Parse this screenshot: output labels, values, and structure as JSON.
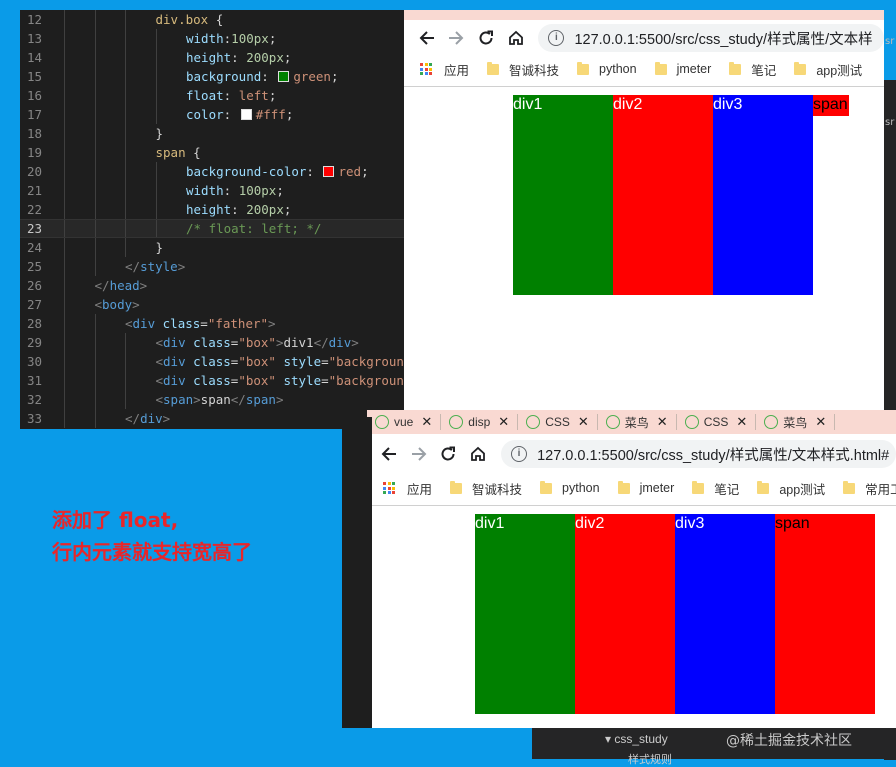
{
  "editor": {
    "lines": [
      {
        "n": "12",
        "indent": 3,
        "tokens": [
          {
            "t": "div.box ",
            "c": "t-sel"
          },
          {
            "t": "{",
            "c": "t-txt"
          }
        ]
      },
      {
        "n": "13",
        "indent": 4,
        "tokens": [
          {
            "t": "width",
            "c": "t-prop"
          },
          {
            "t": ":",
            "c": "t-txt"
          },
          {
            "t": "100px",
            "c": "t-num"
          },
          {
            "t": ";",
            "c": "t-txt"
          }
        ]
      },
      {
        "n": "14",
        "indent": 4,
        "tokens": [
          {
            "t": "height",
            "c": "t-prop"
          },
          {
            "t": ": ",
            "c": "t-txt"
          },
          {
            "t": "200px",
            "c": "t-num"
          },
          {
            "t": ";",
            "c": "t-txt"
          }
        ]
      },
      {
        "n": "15",
        "indent": 4,
        "tokens": [
          {
            "t": "background",
            "c": "t-prop"
          },
          {
            "t": ": ",
            "c": "t-txt"
          },
          {
            "swatch": "#008000"
          },
          {
            "t": "green",
            "c": "t-val"
          },
          {
            "t": ";",
            "c": "t-txt"
          }
        ]
      },
      {
        "n": "16",
        "indent": 4,
        "tokens": [
          {
            "t": "float",
            "c": "t-prop"
          },
          {
            "t": ": ",
            "c": "t-txt"
          },
          {
            "t": "left",
            "c": "t-val"
          },
          {
            "t": ";",
            "c": "t-txt"
          }
        ]
      },
      {
        "n": "17",
        "indent": 4,
        "tokens": [
          {
            "t": "color",
            "c": "t-prop"
          },
          {
            "t": ": ",
            "c": "t-txt"
          },
          {
            "swatch": "#ffffff"
          },
          {
            "t": "#fff",
            "c": "t-val"
          },
          {
            "t": ";",
            "c": "t-txt"
          }
        ]
      },
      {
        "n": "18",
        "indent": 3,
        "tokens": [
          {
            "t": "}",
            "c": "t-txt"
          }
        ]
      },
      {
        "n": "19",
        "indent": 3,
        "tokens": [
          {
            "t": "span ",
            "c": "t-sel"
          },
          {
            "t": "{",
            "c": "t-txt"
          }
        ]
      },
      {
        "n": "20",
        "indent": 4,
        "tokens": [
          {
            "t": "background-color",
            "c": "t-prop"
          },
          {
            "t": ": ",
            "c": "t-txt"
          },
          {
            "swatch": "#ff0000"
          },
          {
            "t": "red",
            "c": "t-val"
          },
          {
            "t": ";",
            "c": "t-txt"
          }
        ]
      },
      {
        "n": "21",
        "indent": 4,
        "tokens": [
          {
            "t": "width",
            "c": "t-prop"
          },
          {
            "t": ": ",
            "c": "t-txt"
          },
          {
            "t": "100px",
            "c": "t-num"
          },
          {
            "t": ";",
            "c": "t-txt"
          }
        ]
      },
      {
        "n": "22",
        "indent": 4,
        "tokens": [
          {
            "t": "height",
            "c": "t-prop"
          },
          {
            "t": ": ",
            "c": "t-txt"
          },
          {
            "t": "200px",
            "c": "t-num"
          },
          {
            "t": ";",
            "c": "t-txt"
          }
        ]
      },
      {
        "n": "23",
        "indent": 4,
        "current": true,
        "tokens": [
          {
            "t": "/* float: left; */",
            "c": "t-com"
          }
        ]
      },
      {
        "n": "24",
        "indent": 3,
        "tokens": [
          {
            "t": "}",
            "c": "t-txt"
          }
        ]
      },
      {
        "n": "25",
        "indent": 2,
        "tokens": [
          {
            "t": "</",
            "c": "t-pun"
          },
          {
            "t": "style",
            "c": "t-tag"
          },
          {
            "t": ">",
            "c": "t-pun"
          }
        ]
      },
      {
        "n": "26",
        "indent": 1,
        "tokens": [
          {
            "t": "</",
            "c": "t-pun"
          },
          {
            "t": "head",
            "c": "t-tag"
          },
          {
            "t": ">",
            "c": "t-pun"
          }
        ]
      },
      {
        "n": "27",
        "indent": 1,
        "tokens": [
          {
            "t": "<",
            "c": "t-pun"
          },
          {
            "t": "body",
            "c": "t-tag"
          },
          {
            "t": ">",
            "c": "t-pun"
          }
        ]
      },
      {
        "n": "28",
        "indent": 2,
        "tokens": [
          {
            "t": "<",
            "c": "t-pun"
          },
          {
            "t": "div ",
            "c": "t-tag"
          },
          {
            "t": "class",
            "c": "t-attr"
          },
          {
            "t": "=",
            "c": "t-txt"
          },
          {
            "t": "\"father\"",
            "c": "t-str"
          },
          {
            "t": ">",
            "c": "t-pun"
          }
        ]
      },
      {
        "n": "29",
        "indent": 3,
        "tokens": [
          {
            "t": "<",
            "c": "t-pun"
          },
          {
            "t": "div ",
            "c": "t-tag"
          },
          {
            "t": "class",
            "c": "t-attr"
          },
          {
            "t": "=",
            "c": "t-txt"
          },
          {
            "t": "\"box\"",
            "c": "t-str"
          },
          {
            "t": ">",
            "c": "t-pun"
          },
          {
            "t": "div1",
            "c": "t-txt"
          },
          {
            "t": "</",
            "c": "t-pun"
          },
          {
            "t": "div",
            "c": "t-tag"
          },
          {
            "t": ">",
            "c": "t-pun"
          }
        ]
      },
      {
        "n": "30",
        "indent": 3,
        "tokens": [
          {
            "t": "<",
            "c": "t-pun"
          },
          {
            "t": "div ",
            "c": "t-tag"
          },
          {
            "t": "class",
            "c": "t-attr"
          },
          {
            "t": "=",
            "c": "t-txt"
          },
          {
            "t": "\"box\" ",
            "c": "t-str"
          },
          {
            "t": "style",
            "c": "t-attr"
          },
          {
            "t": "=",
            "c": "t-txt"
          },
          {
            "t": "\"background-c",
            "c": "t-str"
          }
        ]
      },
      {
        "n": "31",
        "indent": 3,
        "tokens": [
          {
            "t": "<",
            "c": "t-pun"
          },
          {
            "t": "div ",
            "c": "t-tag"
          },
          {
            "t": "class",
            "c": "t-attr"
          },
          {
            "t": "=",
            "c": "t-txt"
          },
          {
            "t": "\"box\" ",
            "c": "t-str"
          },
          {
            "t": "style",
            "c": "t-attr"
          },
          {
            "t": "=",
            "c": "t-txt"
          },
          {
            "t": "\"background-c",
            "c": "t-str"
          }
        ]
      },
      {
        "n": "32",
        "indent": 3,
        "tokens": [
          {
            "t": "<",
            "c": "t-pun"
          },
          {
            "t": "span",
            "c": "t-tag"
          },
          {
            "t": ">",
            "c": "t-pun"
          },
          {
            "t": "span",
            "c": "t-txt"
          },
          {
            "t": "</",
            "c": "t-pun"
          },
          {
            "t": "span",
            "c": "t-tag"
          },
          {
            "t": ">",
            "c": "t-pun"
          }
        ]
      },
      {
        "n": "33",
        "indent": 2,
        "tokens": [
          {
            "t": "</",
            "c": "t-pun"
          },
          {
            "t": "div",
            "c": "t-tag"
          },
          {
            "t": ">",
            "c": "t-pun"
          }
        ]
      }
    ]
  },
  "browser1": {
    "url": "127.0.0.1:5500/src/css_study/样式属性/文本样",
    "bookmarks": [
      "应用",
      "智诚科技",
      "python",
      "jmeter",
      "笔记",
      "app测试"
    ],
    "boxes": [
      {
        "label": "div1",
        "color": "#008000"
      },
      {
        "label": "div2",
        "color": "#ff0000"
      },
      {
        "label": "div3",
        "color": "#0000ff"
      }
    ],
    "span_label": "span"
  },
  "browser2": {
    "tabs": [
      "vue",
      "disp",
      "CSS",
      "菜鸟",
      "CSS",
      "菜鸟"
    ],
    "url": "127.0.0.1:5500/src/css_study/样式属性/文本样式.html#",
    "bookmarks": [
      "应用",
      "智诚科技",
      "python",
      "jmeter",
      "笔记",
      "app测试",
      "常用工"
    ],
    "boxes": [
      {
        "label": "div1",
        "color": "#008000"
      },
      {
        "label": "div2",
        "color": "#ff0000"
      },
      {
        "label": "div3",
        "color": "#0000ff"
      },
      {
        "label": "span",
        "color": "#ff0000"
      }
    ]
  },
  "note": {
    "line1": "添加了 float,",
    "line2": "行内元素就支持宽高了"
  },
  "explorer": {
    "folder": "css_study",
    "sub": "样式规则"
  },
  "watermark": "@稀土掘金技术社区",
  "side_text": "sr"
}
